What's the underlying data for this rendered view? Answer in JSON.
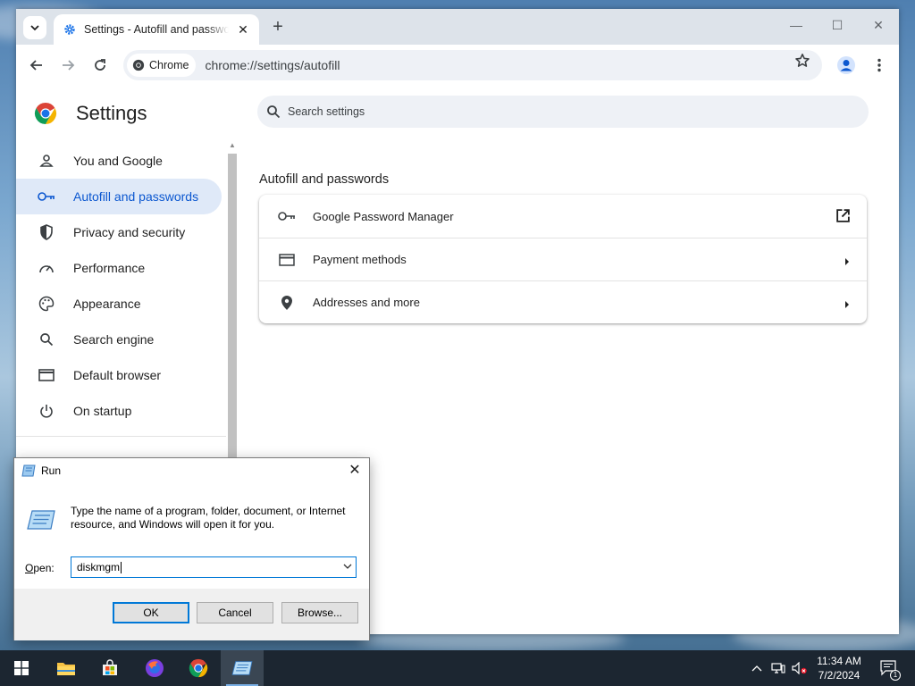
{
  "browser": {
    "tab_title": "Settings - Autofill and passwords",
    "new_tab_symbol": "+",
    "chip_label": "Chrome",
    "url": "chrome://settings/autofill",
    "controls": {
      "minimize": "—",
      "maximize": "☐",
      "close": "✕"
    }
  },
  "settings": {
    "title": "Settings",
    "search_placeholder": "Search settings",
    "sidebar": [
      {
        "label": "You and Google",
        "icon": "person-icon",
        "active": false
      },
      {
        "label": "Autofill and passwords",
        "icon": "key-icon",
        "active": true
      },
      {
        "label": "Privacy and security",
        "icon": "shield-icon",
        "active": false
      },
      {
        "label": "Performance",
        "icon": "speedometer-icon",
        "active": false
      },
      {
        "label": "Appearance",
        "icon": "palette-icon",
        "active": false
      },
      {
        "label": "Search engine",
        "icon": "search-icon",
        "active": false
      },
      {
        "label": "Default browser",
        "icon": "browser-window-icon",
        "active": false
      },
      {
        "label": "On startup",
        "icon": "power-icon",
        "active": false
      }
    ],
    "section_title": "Autofill and passwords",
    "rows": [
      {
        "label": "Google Password Manager",
        "icon": "key-icon",
        "action": "external-link-icon"
      },
      {
        "label": "Payment methods",
        "icon": "credit-card-icon",
        "action": "chevron-right-icon"
      },
      {
        "label": "Addresses and more",
        "icon": "location-pin-icon",
        "action": "chevron-right-icon"
      }
    ]
  },
  "run_dialog": {
    "title": "Run",
    "description": "Type the name of a program, folder, document, or Internet resource, and Windows will open it for you.",
    "open_label_prefix": "O",
    "open_label_rest": "pen:",
    "input_value": "diskmgm",
    "ok_label": "OK",
    "cancel_label": "Cancel",
    "browse_label": "Browse..."
  },
  "taskbar": {
    "time": "11:34 AM",
    "date": "7/2/2024",
    "notification_count": "1"
  },
  "colors": {
    "accent_blue": "#0b57d0",
    "active_bg": "#dfe9f8",
    "taskbar_bg": "#1c2631",
    "dialog_focus": "#0078d7"
  }
}
